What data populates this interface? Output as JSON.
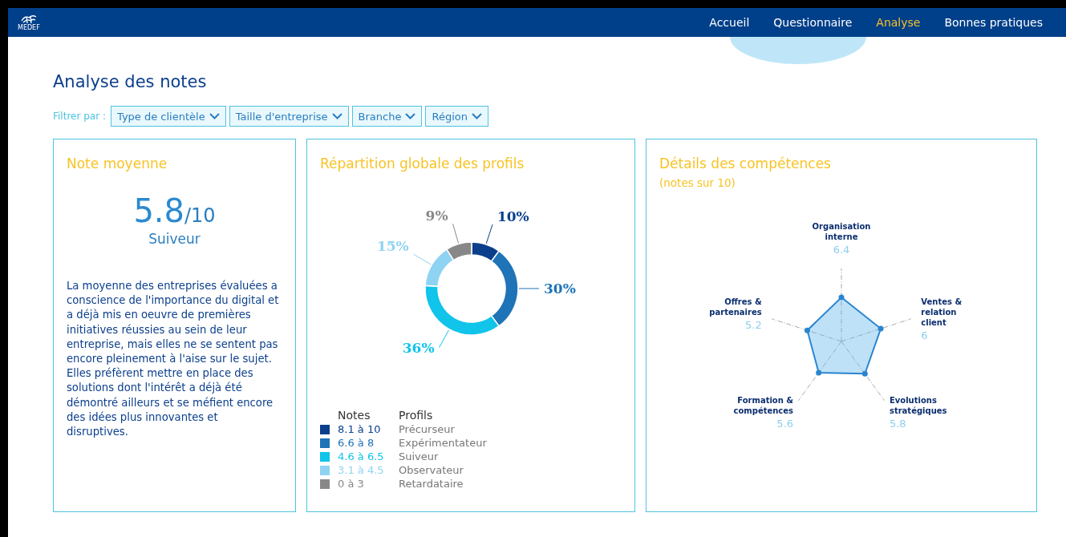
{
  "header": {
    "logo_text": "MEDEF",
    "nav": [
      {
        "label": "Accueil",
        "selected": false
      },
      {
        "label": "Questionnaire",
        "selected": false
      },
      {
        "label": "Analyse",
        "selected": true
      },
      {
        "label": "Bonnes pratiques",
        "selected": false
      }
    ]
  },
  "page_title": "Analyse des notes",
  "filters": {
    "label": "Filtrer par :",
    "options": [
      "Type de clientèle",
      "Taille d'entreprise",
      "Branche",
      "Région"
    ]
  },
  "score_card": {
    "title": "Note moyenne",
    "score": "5.8",
    "out_of": "/10",
    "profile": "Suiveur",
    "description": "La moyenne des entreprises évaluées a conscience de l'importance du digital et a déjà mis en oeuvre de premières initiatives réussies au sein de leur entreprise, mais elles ne se sentent pas encore pleinement à l'aise sur le sujet. Elles préfèrent mettre en place des solutions dont l'intérêt a déjà été démontré ailleurs et se méfient encore des idées plus innovantes et disruptives."
  },
  "profiles_card": {
    "title": "Répartition globale des profils",
    "chart_data": {
      "type": "donut",
      "values": [
        10,
        30,
        36,
        15,
        9
      ],
      "value_labels": [
        "10%",
        "30%",
        "36%",
        "15%",
        "9%"
      ]
    },
    "legend": {
      "notes_header": "Notes",
      "profiles_header": "Profils",
      "items": [
        {
          "range": "8.1 à 10",
          "profile": "Précurseur",
          "color": "#0b3f8c"
        },
        {
          "range": "6.6 à 8",
          "profile": "Expérimentateur",
          "color": "#1f73b7"
        },
        {
          "range": "4.6 à 6.5",
          "profile": "Suiveur",
          "color": "#10c4ea"
        },
        {
          "range": "3.1 à 4.5",
          "profile": "Observateur",
          "color": "#8fd3f3"
        },
        {
          "range": "0 à 3",
          "profile": "Retardataire",
          "color": "#888888"
        }
      ]
    }
  },
  "skills_card": {
    "title": "Détails des compétences",
    "subtitle": "(notes sur 10)",
    "axes": [
      {
        "label_lines": [
          "Organisation",
          "interne"
        ],
        "value": "6.4"
      },
      {
        "label_lines": [
          "Offres &",
          "partenaires"
        ],
        "value": "5.2"
      },
      {
        "label_lines": [
          "Ventes &",
          "relation",
          "client"
        ],
        "value": "6"
      },
      {
        "label_lines": [
          "Formation &",
          "compétences"
        ],
        "value": "5.6"
      },
      {
        "label_lines": [
          "Evolutions",
          "stratégiques"
        ],
        "value": "5.8"
      }
    ]
  }
}
